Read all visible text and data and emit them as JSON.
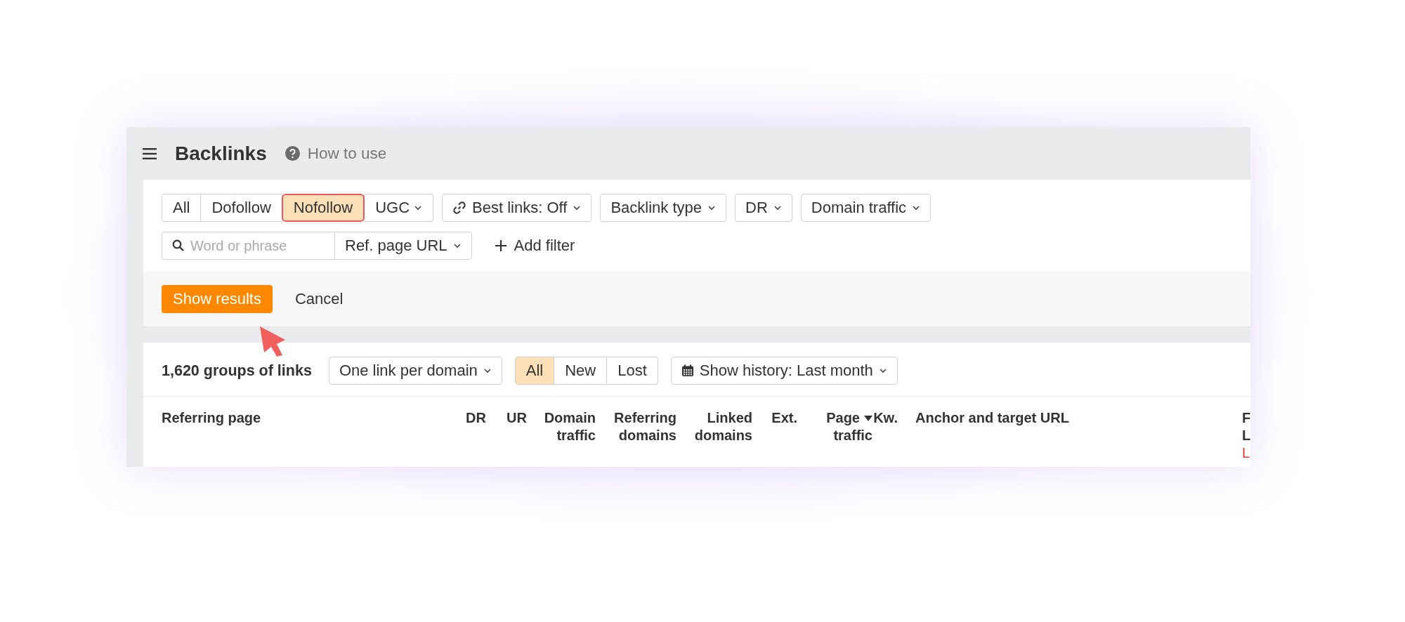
{
  "header": {
    "title": "Backlinks",
    "help_link": "How to use"
  },
  "filters": {
    "link_type_tabs": [
      {
        "label": "All",
        "selected": false,
        "highlighted": false,
        "dropdown": false
      },
      {
        "label": "Dofollow",
        "selected": false,
        "highlighted": false,
        "dropdown": false
      },
      {
        "label": "Nofollow",
        "selected": true,
        "highlighted": true,
        "dropdown": false
      },
      {
        "label": "UGC",
        "selected": false,
        "highlighted": false,
        "dropdown": true
      }
    ],
    "dropdowns": [
      {
        "label": "Best links: Off",
        "kind": "link"
      },
      {
        "label": "Backlink type",
        "kind": "plain"
      },
      {
        "label": "DR",
        "kind": "plain"
      },
      {
        "label": "Domain traffic",
        "kind": "plain"
      }
    ],
    "search": {
      "placeholder": "Word or phrase"
    },
    "scope_dropdown": "Ref. page URL",
    "add_filter": "Add filter"
  },
  "actions": {
    "primary": "Show results",
    "secondary": "Cancel"
  },
  "results": {
    "count": "1,620 groups of links",
    "grouping": "One link per domain",
    "status_tabs": [
      {
        "label": "All",
        "selected": true
      },
      {
        "label": "New",
        "selected": false
      },
      {
        "label": "Lost",
        "selected": false
      }
    ],
    "history": "Show history: Last month"
  },
  "table": {
    "columns": [
      {
        "lines": [
          "Referring page"
        ],
        "sorted": false
      },
      {
        "lines": [
          "DR"
        ],
        "sorted": false
      },
      {
        "lines": [
          "UR"
        ],
        "sorted": false
      },
      {
        "lines": [
          "Domain",
          "traffic"
        ],
        "sorted": false
      },
      {
        "lines": [
          "Referring",
          "domains"
        ],
        "sorted": false
      },
      {
        "lines": [
          "Linked",
          "domains"
        ],
        "sorted": false
      },
      {
        "lines": [
          "Ext."
        ],
        "sorted": false
      },
      {
        "lines": [
          "Page",
          "traffic"
        ],
        "sorted": true
      },
      {
        "lines": [
          "Kw."
        ],
        "sorted": false
      },
      {
        "lines": [
          "Anchor and target URL"
        ],
        "sorted": false
      },
      {
        "lines": [
          "F",
          "L"
        ],
        "sorted": false,
        "note": "L"
      }
    ]
  }
}
